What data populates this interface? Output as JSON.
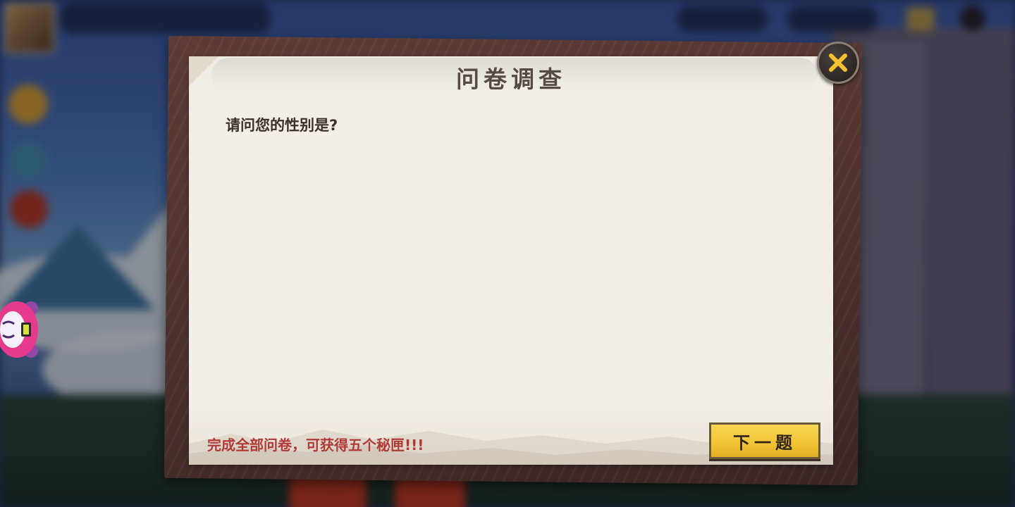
{
  "dialog": {
    "title": "问卷调查",
    "question": "请问您的性别是?",
    "reward_hint": "完成全部问卷，可获得五个秘匣!!!",
    "next_button_label": "下一题",
    "close_icon": "close-icon"
  },
  "colors": {
    "paper": "#f3efe7",
    "frame": "#4a2f2c",
    "title_text": "#574c45",
    "question_text": "#3b302c",
    "hint_text": "#b23a36",
    "button": "#f2c638",
    "close_x": "#f6c12e"
  },
  "background": {
    "mascot_icon": "mascot-icon"
  }
}
